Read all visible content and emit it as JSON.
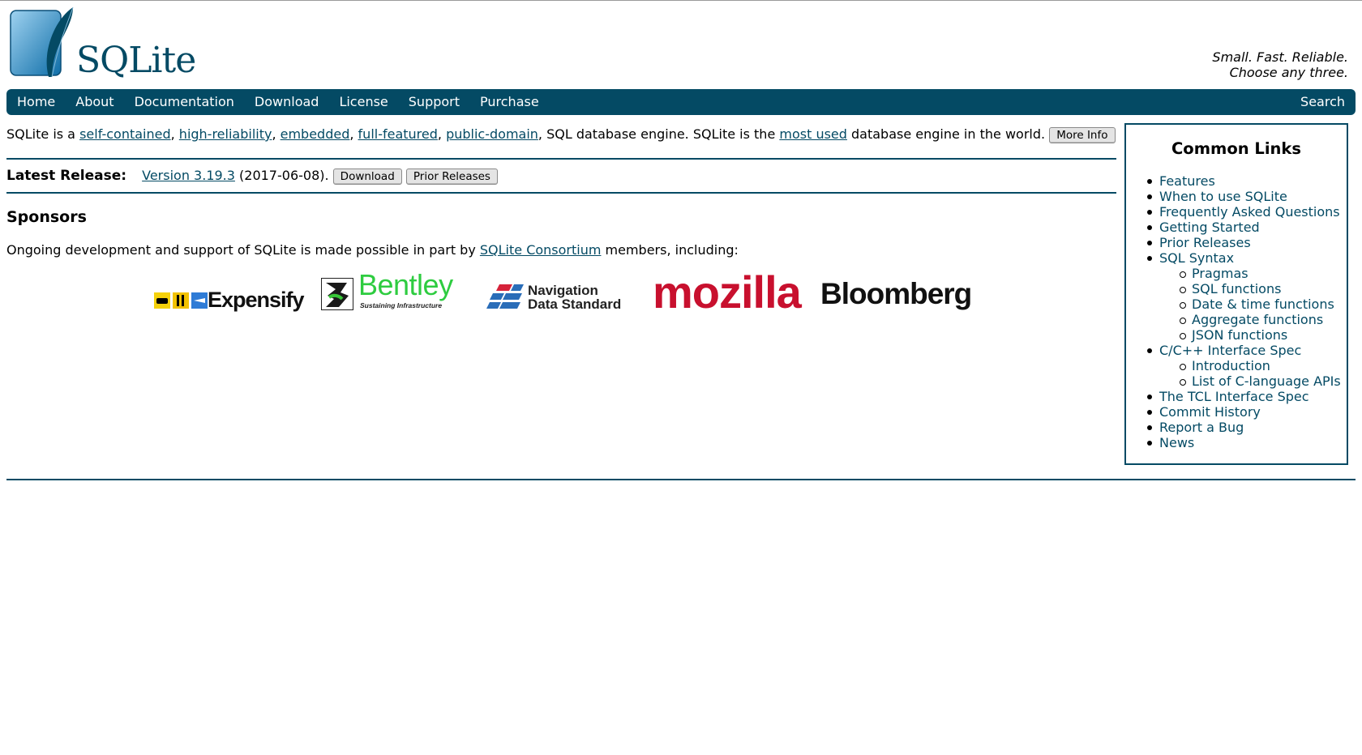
{
  "header": {
    "logo_text": "SQLite",
    "tagline_line1": "Small. Fast. Reliable.",
    "tagline_line2": "Choose any three."
  },
  "nav": {
    "items": [
      "Home",
      "About",
      "Documentation",
      "Download",
      "License",
      "Support",
      "Purchase"
    ],
    "search": "Search"
  },
  "intro": {
    "prefix": "SQLite is a ",
    "links": [
      "self-contained",
      "high-reliability",
      "embedded",
      "full-featured",
      "public-domain"
    ],
    "middle": ", SQL database engine. SQLite is the ",
    "most_used": "most used",
    "suffix": " database engine in the world.",
    "more_info": "More Info"
  },
  "release": {
    "label": "Latest Release:",
    "version": "Version 3.19.3",
    "date": " (2017-06-08).",
    "download": "Download",
    "prior": "Prior Releases"
  },
  "sponsors": {
    "title": "Sponsors",
    "text_prefix": "Ongoing development and support of SQLite is made possible in part by ",
    "consortium": "SQLite Consortium",
    "text_suffix": " members, including:",
    "logos": {
      "expensify": "Expensify",
      "bentley": "Bentley",
      "bentley_sub": "Sustaining Infrastructure",
      "nds_line1": "Navigation",
      "nds_line2": "Data Standard",
      "mozilla": "mozilla",
      "bloomberg": "Bloomberg"
    }
  },
  "sidebar": {
    "title": "Common Links",
    "links": [
      {
        "label": "Features",
        "level": 1
      },
      {
        "label": "When to use SQLite",
        "level": 1
      },
      {
        "label": "Frequently Asked Questions",
        "level": 1
      },
      {
        "label": "Getting Started",
        "level": 1
      },
      {
        "label": "Prior Releases",
        "level": 1
      },
      {
        "label": "SQL Syntax",
        "level": 1
      },
      {
        "label": "Pragmas",
        "level": 2
      },
      {
        "label": "SQL functions",
        "level": 2
      },
      {
        "label": "Date & time functions",
        "level": 2
      },
      {
        "label": "Aggregate functions",
        "level": 2
      },
      {
        "label": "JSON functions",
        "level": 2
      },
      {
        "label": "C/C++ Interface Spec",
        "level": 1
      },
      {
        "label": "Introduction",
        "level": 2
      },
      {
        "label": "List of C-language APIs",
        "level": 2
      },
      {
        "label": "The TCL Interface Spec",
        "level": 1
      },
      {
        "label": "Commit History",
        "level": 1
      },
      {
        "label": "Report a Bug",
        "level": 1
      },
      {
        "label": "News",
        "level": 1
      }
    ]
  },
  "colors": {
    "brand": "#044a64",
    "link": "#044a64",
    "mozilla": "#c8102e",
    "bentley": "#2ecc40"
  }
}
